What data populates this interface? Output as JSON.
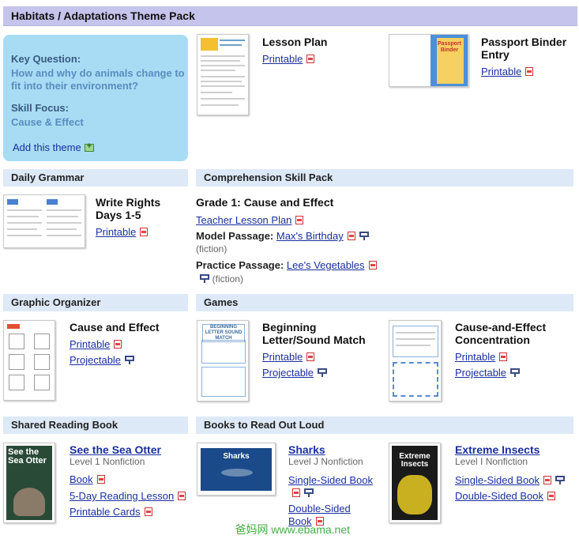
{
  "banner": {
    "title": "Habitats / Adaptations Theme Pack"
  },
  "key_box": {
    "question_label": "Key Question:",
    "question": "How and why do animals change to fit into their environment?",
    "skill_label": "Skill Focus:",
    "skill": "Cause & Effect",
    "add_label": "Add this theme"
  },
  "lesson_plan": {
    "title": "Lesson Plan",
    "printable": "Printable"
  },
  "passport": {
    "title": "Passport Binder Entry",
    "printable": "Printable",
    "thumb_title": "Passport Binder"
  },
  "sections": {
    "daily_grammar": "Daily Grammar",
    "comprehension": "Comprehension Skill Pack",
    "graphic_organizer": "Graphic Organizer",
    "games": "Games",
    "shared_reading": "Shared Reading Book",
    "read_aloud": "Books to Read Out Loud"
  },
  "grammar": {
    "title": "Write Rights Days 1-5",
    "printable": "Printable"
  },
  "comprehension": {
    "heading": "Grade 1: Cause and Effect",
    "teacher_plan": "Teacher Lesson Plan",
    "model_label": "Model Passage:",
    "model_link": "Max's Birthday",
    "model_note": "(fiction)",
    "practice_label": "Practice Passage:",
    "practice_link": "Lee's Vegetables",
    "practice_note": "(fiction)"
  },
  "organizer": {
    "title": "Cause and Effect",
    "printable": "Printable",
    "projectable": "Projectable"
  },
  "game1": {
    "title": "Beginning Letter/Sound Match",
    "printable": "Printable",
    "projectable": "Projectable",
    "thumb_title": "BEGINNING LETTER SOUND MATCH"
  },
  "game2": {
    "title": "Cause-and-Effect Concentration",
    "printable": "Printable",
    "projectable": "Projectable"
  },
  "shared_book": {
    "title": "See the Sea Otter",
    "level": "Level 1 Nonfiction",
    "book": "Book",
    "five_day": "5-Day Reading Lesson",
    "cards": "Printable Cards",
    "cover_text": "See the Sea Otter"
  },
  "sharks": {
    "title": "Sharks",
    "level": "Level J Nonfiction",
    "single": "Single-Sided Book",
    "double": "Double-Sided Book",
    "cover_text": "Sharks"
  },
  "insects": {
    "title": "Extreme Insects",
    "level": "Level I Nonfiction",
    "single": "Single-Sided Book",
    "double": "Double-Sided Book",
    "cover_text": "Extreme Insects"
  },
  "watermark": "爸妈网 www.ebama.net",
  "colors": {
    "banner": "#c4c4ec",
    "key_box": "#a7dcf4",
    "section_bar": "#dde9f7",
    "link": "#1a2f9e"
  }
}
